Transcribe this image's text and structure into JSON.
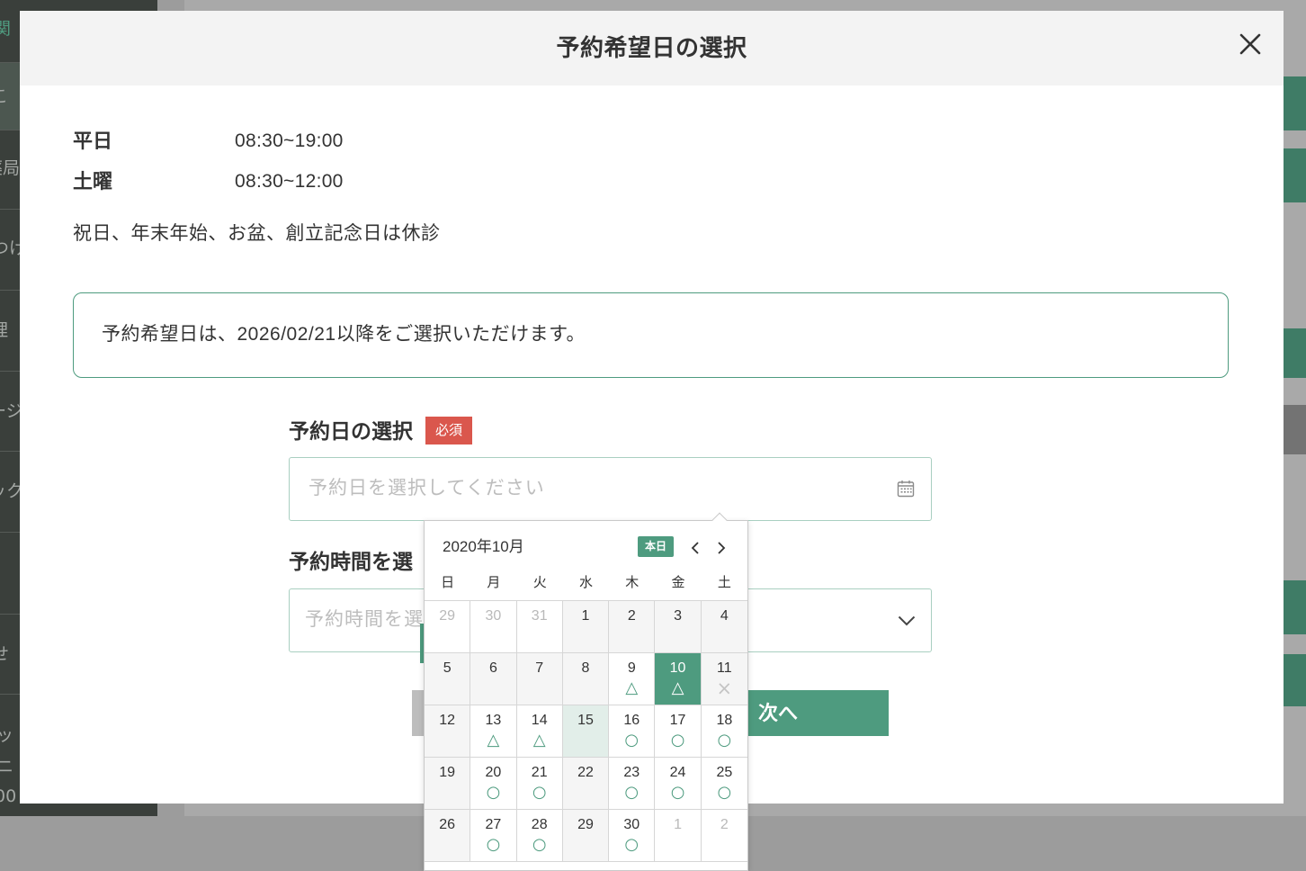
{
  "background_page": {
    "sidebar_fragments": [
      "関",
      "こ",
      "薬局",
      "つけ",
      "理",
      "ージ",
      "ック",
      "せ",
      "ッ",
      "ニ",
      "00"
    ]
  },
  "modal": {
    "title": "予約希望日の選択",
    "close_icon": "close-icon",
    "hours": [
      {
        "label": "平日",
        "time": "08:30~19:00"
      },
      {
        "label": "土曜",
        "time": "08:30~12:00"
      }
    ],
    "closed_note": "祝日、年末年始、お盆、創立記念日は休診",
    "notice": "予約希望日は、2026/02/21以降をご選択いただけます。",
    "date_field": {
      "label": "予約日の選択",
      "required_badge": "必須",
      "placeholder": "予約日を選択してください",
      "icon": "calendar-icon"
    },
    "time_field": {
      "label": "予約時間を選",
      "placeholder": "予約時間を選",
      "icon": "chevron-down-icon"
    },
    "next_button": "次へ"
  },
  "calendar": {
    "month_label": "2020年10月",
    "today_button": "本日",
    "prev_icon": "chevron-left-icon",
    "next_icon": "chevron-right-icon",
    "weekdays": [
      "日",
      "月",
      "火",
      "水",
      "木",
      "金",
      "土"
    ],
    "weeks": [
      [
        {
          "day": "29",
          "other_month": true
        },
        {
          "day": "30",
          "other_month": true
        },
        {
          "day": "31",
          "other_month": true
        },
        {
          "day": "1",
          "closed": true
        },
        {
          "day": "2",
          "closed": true
        },
        {
          "day": "3",
          "closed": true
        },
        {
          "day": "4",
          "closed": true
        }
      ],
      [
        {
          "day": "5",
          "closed": true
        },
        {
          "day": "6",
          "closed": true
        },
        {
          "day": "7",
          "closed": true
        },
        {
          "day": "8",
          "closed": true
        },
        {
          "day": "9",
          "mark": "△"
        },
        {
          "day": "10",
          "mark": "△",
          "selected": true
        },
        {
          "day": "11",
          "mark": "×",
          "closed": true
        }
      ],
      [
        {
          "day": "12",
          "closed": true
        },
        {
          "day": "13",
          "mark": "△"
        },
        {
          "day": "14",
          "mark": "△"
        },
        {
          "day": "15",
          "today": true
        },
        {
          "day": "16",
          "mark": "○"
        },
        {
          "day": "17",
          "mark": "○"
        },
        {
          "day": "18",
          "mark": "○"
        }
      ],
      [
        {
          "day": "19",
          "closed": true
        },
        {
          "day": "20",
          "mark": "○"
        },
        {
          "day": "21",
          "mark": "○"
        },
        {
          "day": "22",
          "closed": true
        },
        {
          "day": "23",
          "mark": "○"
        },
        {
          "day": "24",
          "mark": "○"
        },
        {
          "day": "25",
          "mark": "○"
        }
      ],
      [
        {
          "day": "26",
          "closed": true
        },
        {
          "day": "27",
          "mark": "○"
        },
        {
          "day": "28",
          "mark": "○"
        },
        {
          "day": "29",
          "closed": true
        },
        {
          "day": "30",
          "mark": "○"
        },
        {
          "day": "1",
          "other_month": true
        },
        {
          "day": "2",
          "other_month": true
        }
      ]
    ]
  },
  "colors": {
    "accent": "#4e9b7f",
    "required": "#da574d",
    "today_bg": "#e2eee9",
    "closed_bg": "#f5f5f5",
    "muted_text": "#b9b9b9",
    "field_border": "#a9cfc1",
    "overlay": "#9c9c9c",
    "sidebar": "#3a3f3b"
  }
}
